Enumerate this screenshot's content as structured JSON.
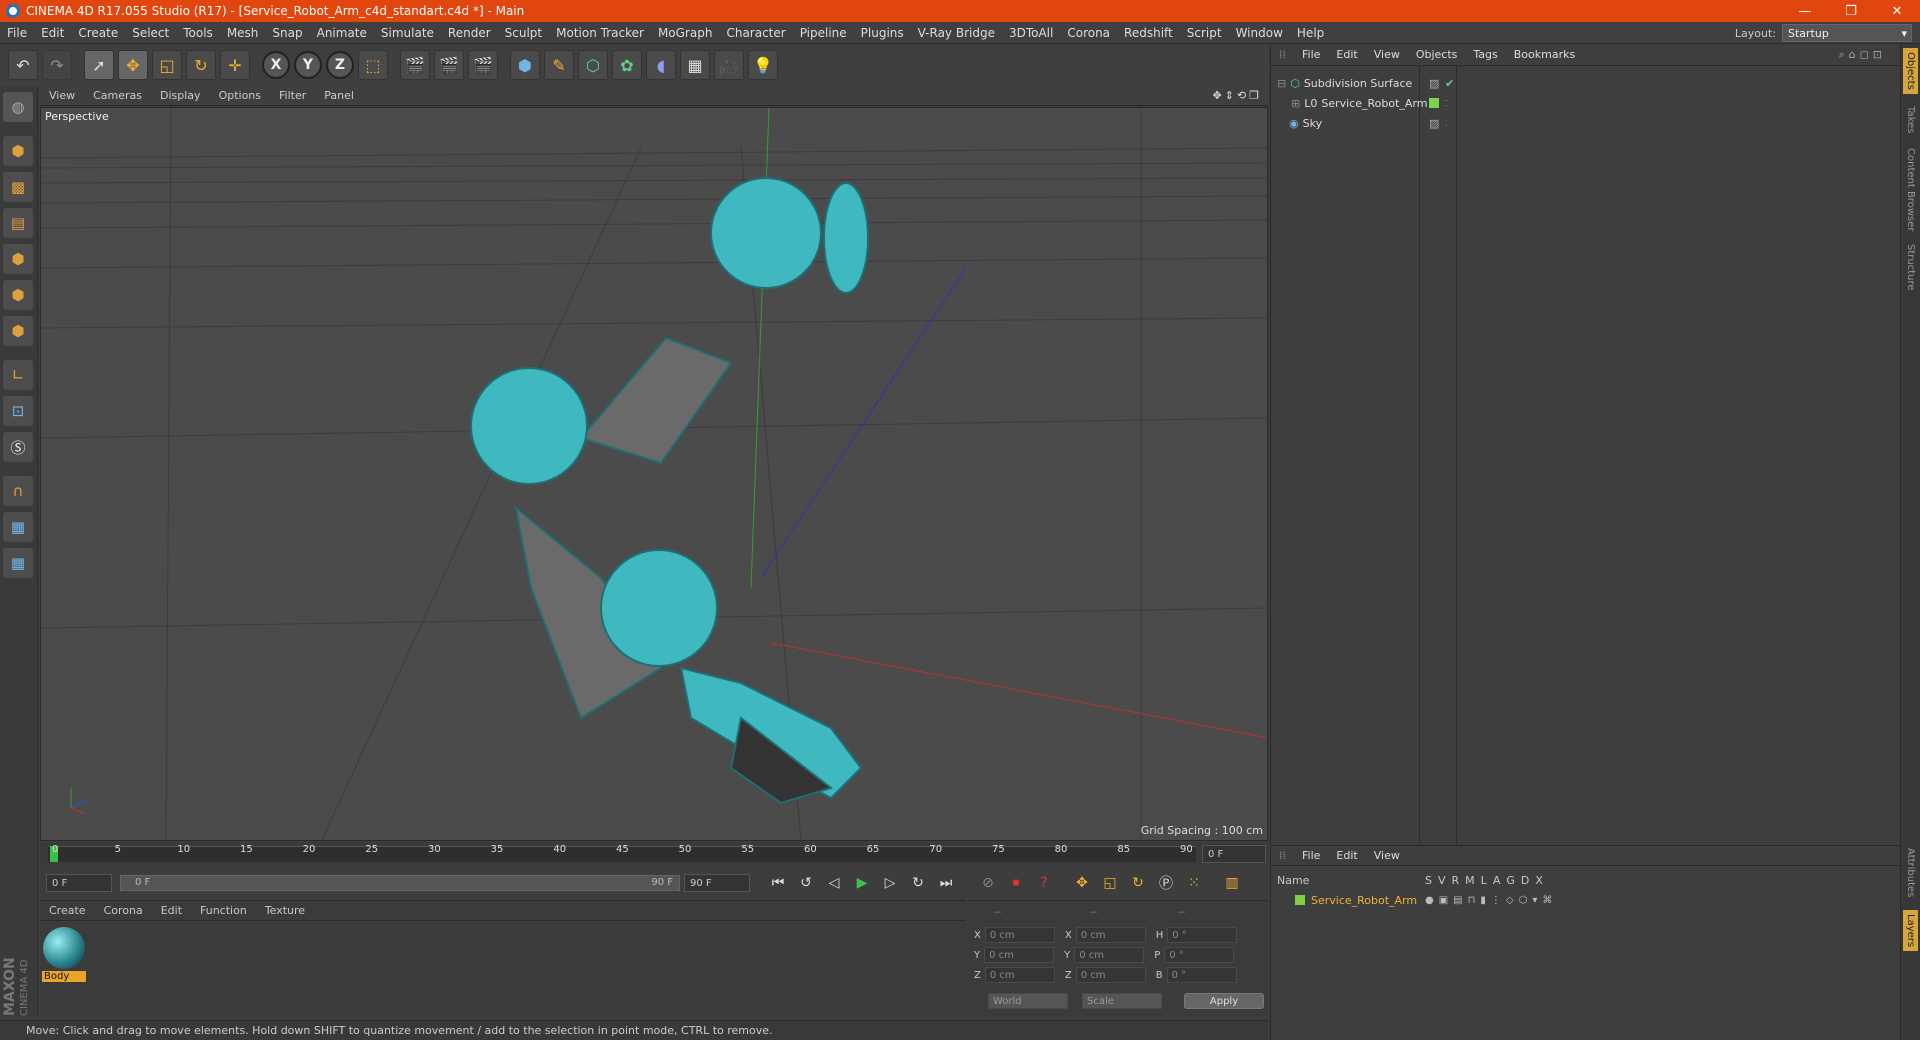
{
  "window": {
    "title": "CINEMA 4D R17.055 Studio (R17) - [Service_Robot_Arm_c4d_standart.c4d *] - Main",
    "controls": [
      "—",
      "❐",
      "✕"
    ]
  },
  "menubar": {
    "items": [
      "File",
      "Edit",
      "Create",
      "Select",
      "Tools",
      "Mesh",
      "Snap",
      "Animate",
      "Simulate",
      "Render",
      "Sculpt",
      "Motion Tracker",
      "MoGraph",
      "Character",
      "Pipeline",
      "Plugins",
      "V-Ray Bridge",
      "3DToAll",
      "Corona",
      "Redshift",
      "Script",
      "Window",
      "Help"
    ],
    "layout_label": "Layout:",
    "layout_value": "Startup"
  },
  "toolbar": {
    "axis_x": "X",
    "axis_y": "Y",
    "axis_z": "Z"
  },
  "viewport": {
    "menu": [
      "View",
      "Cameras",
      "Display",
      "Options",
      "Filter",
      "Panel"
    ],
    "label": "Perspective",
    "grid_spacing": "Grid Spacing : 100 cm",
    "model_color": "#3fb8c0"
  },
  "timeline": {
    "ticks": [
      "0",
      "5",
      "10",
      "15",
      "20",
      "25",
      "30",
      "35",
      "40",
      "45",
      "50",
      "55",
      "60",
      "65",
      "70",
      "75",
      "80",
      "85",
      "90"
    ],
    "current_frame": "0 F",
    "start_field": "0 F",
    "range_start": "0 F",
    "range_end": "90 F",
    "end_field": "90 F"
  },
  "material_panel": {
    "menu": [
      "Create",
      "Corona",
      "Edit",
      "Function",
      "Texture"
    ],
    "material_name": "Body"
  },
  "coord_panel": {
    "headers": [
      "--",
      "--",
      "--"
    ],
    "rows": [
      {
        "a": "X",
        "av": "0 cm",
        "b": "X",
        "bv": "0 cm",
        "c": "H",
        "cv": "0 °"
      },
      {
        "a": "Y",
        "av": "0 cm",
        "b": "Y",
        "bv": "0 cm",
        "c": "P",
        "cv": "0 °"
      },
      {
        "a": "Z",
        "av": "0 cm",
        "b": "Z",
        "bv": "0 cm",
        "c": "B",
        "cv": "0 °"
      }
    ],
    "world": "World",
    "scale": "Scale",
    "apply": "Apply"
  },
  "object_panel": {
    "menu": [
      "File",
      "Edit",
      "View",
      "Objects",
      "Tags",
      "Bookmarks"
    ],
    "objects": [
      "Subdivision Surface",
      "Service_Robot_Arm",
      "Sky"
    ]
  },
  "layer_panel": {
    "menu": [
      "File",
      "Edit",
      "View"
    ],
    "name_header": "Name",
    "columns": [
      "S",
      "V",
      "R",
      "M",
      "L",
      "A",
      "G",
      "D",
      "X"
    ],
    "layer_name": "Service_Robot_Arm",
    "layer_color": "#7cd34a"
  },
  "right_tabs": [
    "Objects",
    "Takes",
    "Content Browser",
    "Structure",
    "Attributes",
    "Layers"
  ],
  "status": "Move: Click and drag to move elements. Hold down SHIFT to quantize movement / add to the selection in point mode, CTRL to remove.",
  "branding": {
    "maxon": "MAXON",
    "c4d": "CINEMA 4D"
  }
}
